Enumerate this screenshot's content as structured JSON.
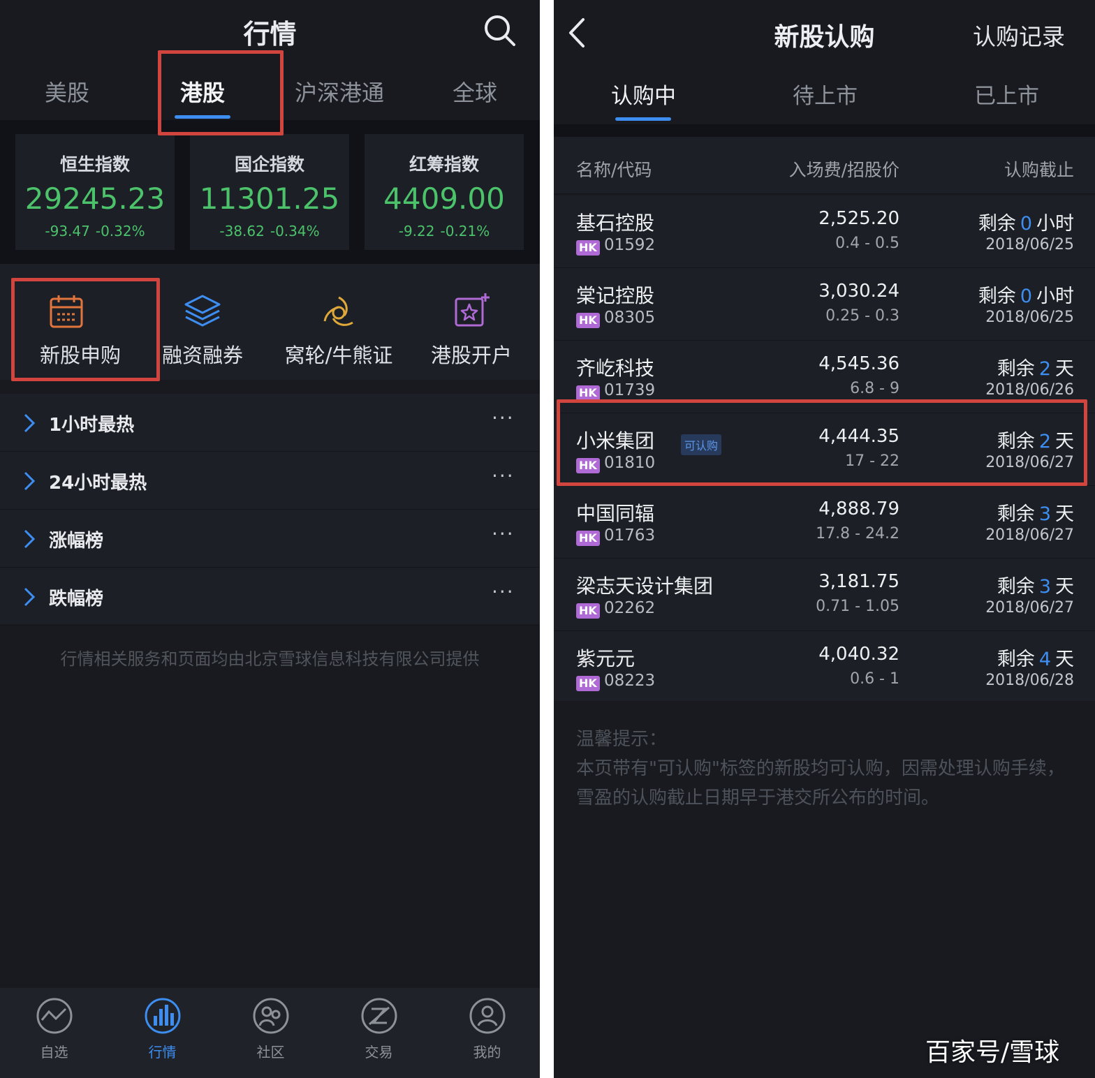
{
  "left": {
    "title": "行情",
    "tabs": [
      {
        "label": "美股"
      },
      {
        "label": "港股"
      },
      {
        "label": "沪深港通"
      },
      {
        "label": "全球"
      }
    ],
    "indices": [
      {
        "name": "恒生指数",
        "value": "29245.23",
        "change": "-93.47",
        "pct": "-0.32%"
      },
      {
        "name": "国企指数",
        "value": "11301.25",
        "change": "-38.62",
        "pct": "-0.34%"
      },
      {
        "name": "红筹指数",
        "value": "4409.00",
        "change": "-9.22",
        "pct": "-0.21%"
      }
    ],
    "quick": [
      {
        "label": "新股申购",
        "icon": "calendar-icon"
      },
      {
        "label": "融资融券",
        "icon": "layers-icon"
      },
      {
        "label": "窝轮/牛熊证",
        "icon": "swirl-icon"
      },
      {
        "label": "港股开户",
        "icon": "flower-icon"
      }
    ],
    "lists": [
      {
        "label": "1小时最热",
        "more": "···"
      },
      {
        "label": "24小时最热",
        "more": "···"
      },
      {
        "label": "涨幅榜",
        "more": "···"
      },
      {
        "label": "跌幅榜",
        "more": "···"
      }
    ],
    "disclaimer": "行情相关服务和页面均由北京雪球信息科技有限公司提供",
    "nav": [
      {
        "label": "自选",
        "icon": "watchlist-icon"
      },
      {
        "label": "行情",
        "icon": "market-icon"
      },
      {
        "label": "社区",
        "icon": "community-icon"
      },
      {
        "label": "交易",
        "icon": "trade-icon"
      },
      {
        "label": "我的",
        "icon": "profile-icon"
      }
    ]
  },
  "right": {
    "title": "新股认购",
    "record": "认购记录",
    "tabs": [
      {
        "label": "认购中"
      },
      {
        "label": "待上市"
      },
      {
        "label": "已上市"
      }
    ],
    "headers": {
      "name": "名称/代码",
      "fee": "入场费/招股价",
      "deadline": "认购截止"
    },
    "rows": [
      {
        "name": "基石控股",
        "market": "HK",
        "code": "01592",
        "fee": "2,525.20",
        "price": "0.4 - 0.5",
        "remain_prefix": "剩余",
        "remain_num": "0",
        "remain_unit": "小时",
        "date": "2018/06/25"
      },
      {
        "name": "棠记控股",
        "market": "HK",
        "code": "08305",
        "fee": "3,030.24",
        "price": "0.25 - 0.3",
        "remain_prefix": "剩余",
        "remain_num": "0",
        "remain_unit": "小时",
        "date": "2018/06/25"
      },
      {
        "name": "齐屹科技",
        "market": "HK",
        "code": "01739",
        "fee": "4,545.36",
        "price": "6.8 - 9",
        "remain_prefix": "剩余",
        "remain_num": "2",
        "remain_unit": "天",
        "date": "2018/06/26"
      },
      {
        "name": "小米集团",
        "tag": "可认购",
        "market": "HK",
        "code": "01810",
        "fee": "4,444.35",
        "price": "17 - 22",
        "remain_prefix": "剩余",
        "remain_num": "2",
        "remain_unit": "天",
        "date": "2018/06/27"
      },
      {
        "name": "中国同辐",
        "market": "HK",
        "code": "01763",
        "fee": "4,888.79",
        "price": "17.8 - 24.2",
        "remain_prefix": "剩余",
        "remain_num": "3",
        "remain_unit": "天",
        "date": "2018/06/27"
      },
      {
        "name": "梁志天设计集团",
        "market": "HK",
        "code": "02262",
        "fee": "3,181.75",
        "price": "0.71 - 1.05",
        "remain_prefix": "剩余",
        "remain_num": "3",
        "remain_unit": "天",
        "date": "2018/06/27"
      },
      {
        "name": "紫元元",
        "market": "HK",
        "code": "08223",
        "fee": "4,040.32",
        "price": "0.6 - 1",
        "remain_prefix": "剩余",
        "remain_num": "4",
        "remain_unit": "天",
        "date": "2018/06/28"
      }
    ],
    "tips_title": "温馨提示：",
    "tips_body": "本页带有\"可认购\"标签的新股均可认购，因需处理认购手续，雪盈的认购截止日期早于港交所公布的时间。"
  },
  "watermark": "百家号/雪球",
  "colors": {
    "accent": "#3d8ef0",
    "up_green": "#4cc36b",
    "highlight_red": "#d2453f",
    "hk_badge": "#b06ad6"
  }
}
